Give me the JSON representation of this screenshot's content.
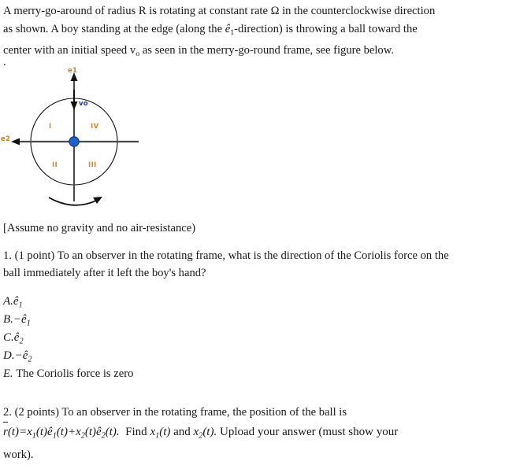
{
  "document": {
    "intro": {
      "line1_a": "A merry-go-around of radius R is rotating at constant rate ",
      "line1_omega": "Ω",
      "line1_b": " in the counterclockwise direction",
      "line2_a": "as shown.  A boy standing at the edge (along the ",
      "line2_e": "ê",
      "line2_sub": "1",
      "line2_b": "-direction) is throwing a ball toward the",
      "line3_a": "center with an initial speed v",
      "line3_sub": "o",
      "line3_b": " as seen in the merry-go-round frame, see figure below.",
      "line4": "."
    },
    "figure": {
      "label_e1": "e1",
      "label_e2": "e2",
      "label_vo": "vo",
      "quadrant_1": "I",
      "quadrant_2": "II",
      "quadrant_3": "III",
      "quadrant_4": "IV",
      "center_dot_color": "#1f5fd0",
      "axis_color": "#4a4a4a",
      "circle_color": "#111111",
      "label_color_letter": "#c8822a",
      "label_color_digit": "#1f3a93",
      "quadrant_color": "#d08a33"
    },
    "assume_note": "[Assume no gravity and no air-resistance)",
    "question1": {
      "line1": "1. (1 point) To an observer in the rotating frame, what is the direction of the Coriolis force on the",
      "line2": "ball immediately after it left the boy's hand?",
      "choices": [
        {
          "letter": "A.",
          "sign": "",
          "vector": "ê",
          "sub": "1",
          "text": ""
        },
        {
          "letter": "B.",
          "sign": "−",
          "vector": "ê",
          "sub": "1",
          "text": ""
        },
        {
          "letter": "C.",
          "sign": "",
          "vector": "ê",
          "sub": "2",
          "text": ""
        },
        {
          "letter": "D.",
          "sign": "−",
          "vector": "ê",
          "sub": "2",
          "text": ""
        },
        {
          "letter": "E.",
          "sign": "",
          "vector": "",
          "sub": "",
          "text": "The Coriolis force is zero"
        }
      ]
    },
    "question2": {
      "line1": "2. (2 points) To an observer in the rotating frame, the position of the ball is",
      "formula_r": "r",
      "formula_p1": "(t)=x",
      "formula_s1": "1",
      "formula_p2": "(t)ê",
      "formula_s2": "1",
      "formula_p3": "(t)+x",
      "formula_s3": "2",
      "formula_p4": "(t)ê",
      "formula_s4": "2",
      "formula_p5": "(t).",
      "find_word": "Find",
      "find_x1": "x",
      "find_x1_sub": "1",
      "find_x1_t": "(t)",
      "and_word": "and",
      "find_x2": "x",
      "find_x2_sub": "2",
      "find_x2_t": "(t).",
      "upload_text": "Upload your answer (must show your",
      "line3": "work)."
    }
  }
}
